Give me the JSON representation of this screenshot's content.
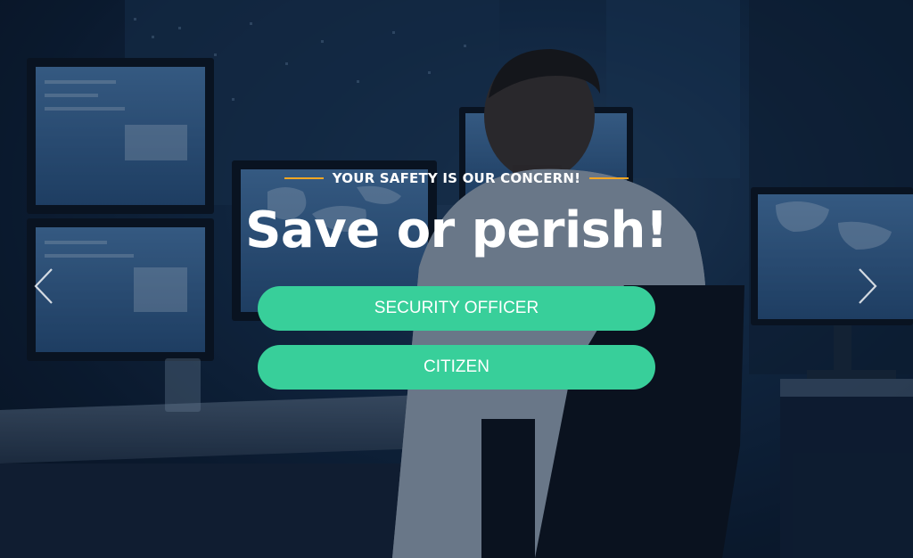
{
  "hero": {
    "tagline": "YOUR SAFETY IS OUR CONCERN!",
    "headline": "Save or perish!",
    "buttons": {
      "security_officer": "SECURITY OFFICER",
      "citizen": "CITIZEN"
    },
    "carousel": {
      "prev_icon": "chevron-left-icon",
      "next_icon": "chevron-right-icon"
    },
    "colors": {
      "accent_line": "#f5a623",
      "button_bg": "#38cf9a",
      "text": "#ffffff"
    }
  }
}
